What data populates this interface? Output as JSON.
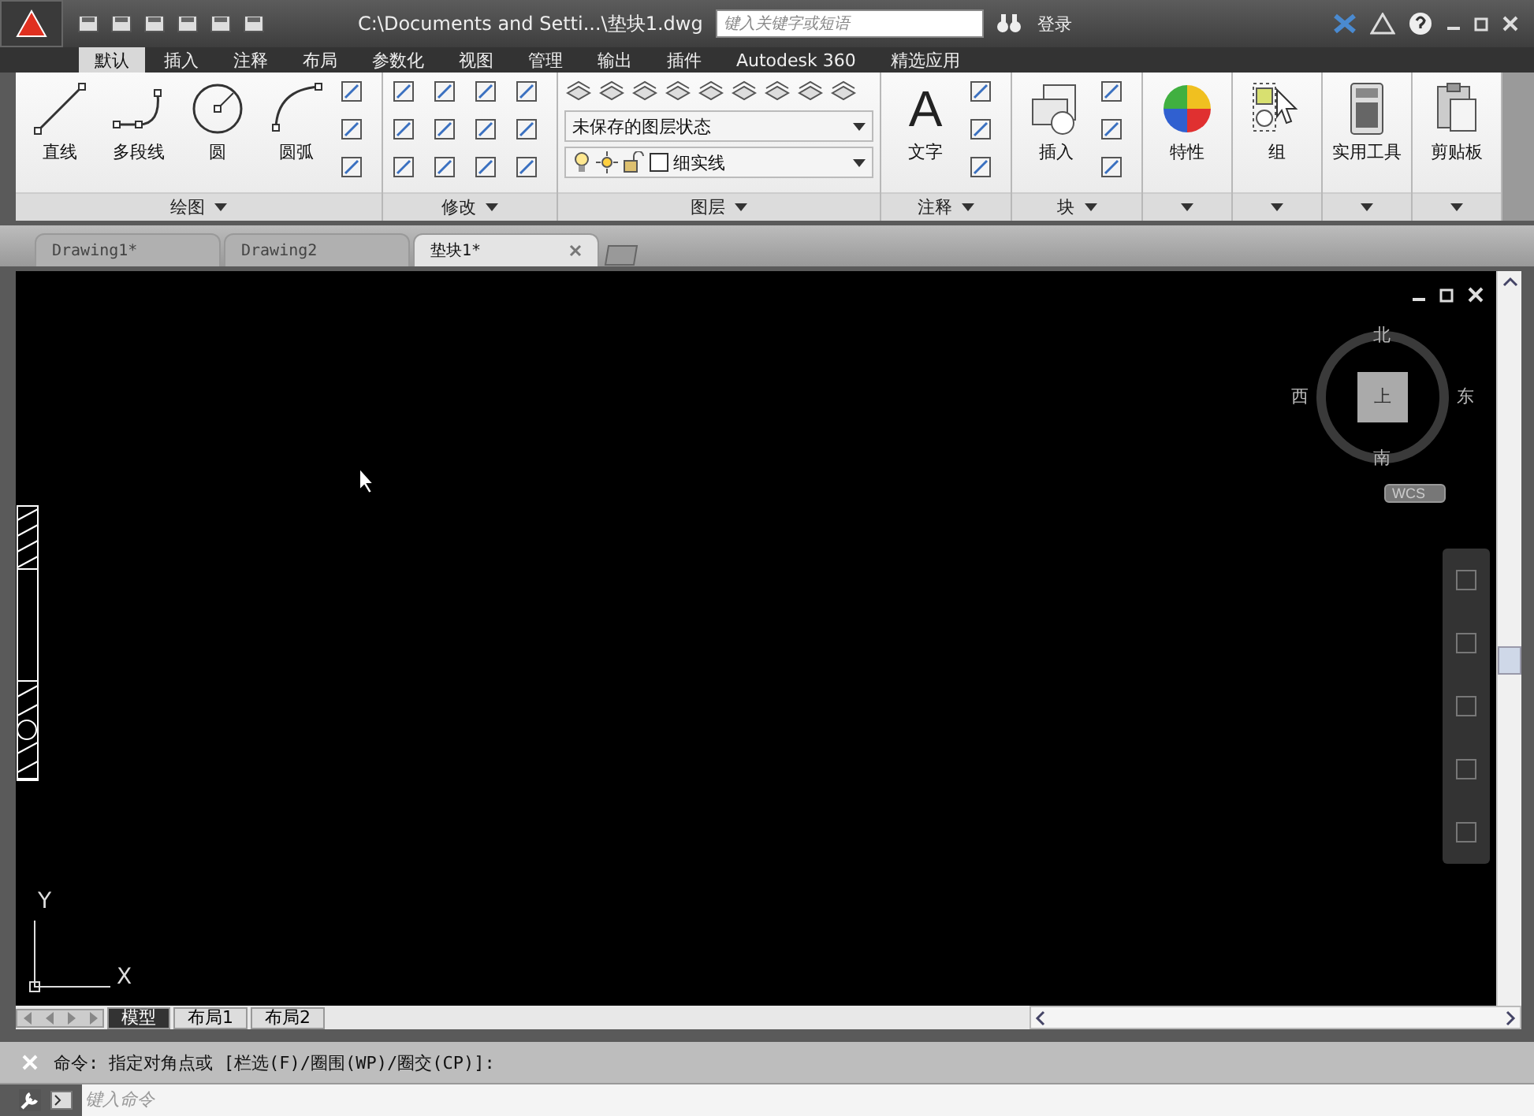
{
  "title_bar": {
    "path": "C:\\Documents and Setti...\\垫块1.dwg",
    "search": {
      "placeholder": "键入关键字或短语"
    },
    "login": "登录"
  },
  "ribbon_tabs": [
    {
      "label": "默认",
      "selected": true
    },
    {
      "label": "插入",
      "selected": false
    },
    {
      "label": "注释",
      "selected": false
    },
    {
      "label": "布局",
      "selected": false
    },
    {
      "label": "参数化",
      "selected": false
    },
    {
      "label": "视图",
      "selected": false
    },
    {
      "label": "管理",
      "selected": false
    },
    {
      "label": "输出",
      "selected": false
    },
    {
      "label": "插件",
      "selected": false
    },
    {
      "label": "Autodesk 360",
      "selected": false
    },
    {
      "label": "精选应用",
      "selected": false
    }
  ],
  "panels": [
    {
      "label": "绘图",
      "kind": "draw",
      "tools": [
        {
          "label": "直线",
          "kind": "line"
        },
        {
          "label": "多段线",
          "kind": "polyline"
        },
        {
          "label": "圆",
          "kind": "circle"
        },
        {
          "label": "圆弧",
          "kind": "arc"
        }
      ]
    },
    {
      "label": "修改",
      "kind": "modify"
    },
    {
      "label": "图层",
      "kind": "layers",
      "dropdowns": [
        "未保存的图层状态",
        "细实线"
      ]
    },
    {
      "label": "注释",
      "kind": "annotate",
      "tools": [
        {
          "label": "文字",
          "kind": "text",
          "glyph": "A"
        }
      ]
    },
    {
      "label": "块",
      "kind": "block",
      "tools": [
        {
          "label": "插入",
          "kind": "insert"
        }
      ]
    },
    {
      "kind": "single",
      "tools": [
        {
          "label": "特性",
          "kind": "properties"
        }
      ]
    },
    {
      "kind": "single",
      "tools": [
        {
          "label": "组",
          "kind": "group"
        }
      ]
    },
    {
      "kind": "single",
      "tools": [
        {
          "label": "实用工具",
          "kind": "utilities"
        }
      ]
    },
    {
      "kind": "single",
      "tools": [
        {
          "label": "剪贴板",
          "kind": "clipboard"
        }
      ]
    }
  ],
  "doc_tabs": [
    {
      "label": "Drawing1*",
      "selected": false
    },
    {
      "label": "Drawing2",
      "selected": false
    },
    {
      "label": "垫块1*",
      "selected": true
    }
  ],
  "viewcube": {
    "north": "北",
    "south": "南",
    "east": "东",
    "west": "西",
    "face": "上",
    "ucs": "WCS"
  },
  "ucs_icon": {
    "x": "X",
    "y": "Y"
  },
  "layout_tabs": [
    {
      "label": "模型",
      "selected": true
    },
    {
      "label": "布局1",
      "selected": false
    },
    {
      "label": "布局2",
      "selected": false
    }
  ],
  "command": {
    "history": "命令: 指定对角点或 [栏选(F)/圈围(WP)/圈交(CP)]:",
    "placeholder": "键入命令"
  }
}
